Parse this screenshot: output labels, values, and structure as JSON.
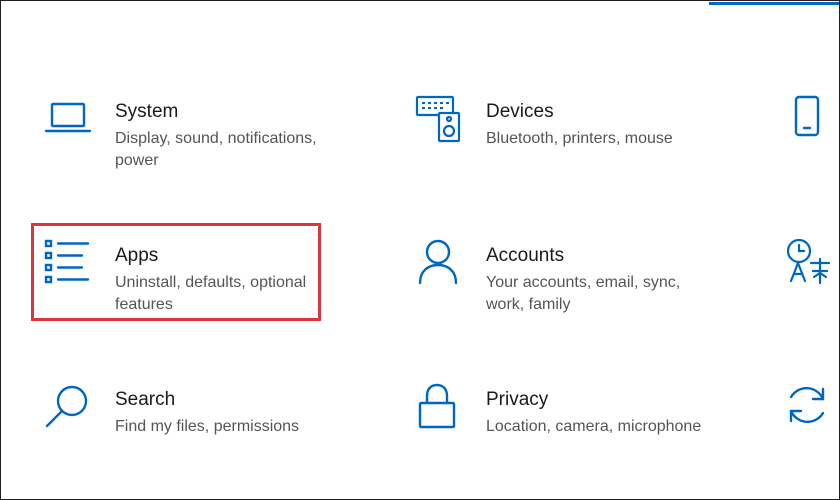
{
  "accent_color": "#0067c0",
  "highlight_color": "#d9363e",
  "tiles": [
    {
      "icon": "laptop-icon",
      "title": "System",
      "description": "Display, sound, notifications, power"
    },
    {
      "icon": "keyboard-speaker-icon",
      "title": "Devices",
      "description": "Bluetooth, printers, mouse"
    },
    {
      "icon": "apps-list-icon",
      "title": "Apps",
      "description": "Uninstall, defaults, optional features"
    },
    {
      "icon": "person-icon",
      "title": "Accounts",
      "description": "Your accounts, email, sync, work, family"
    },
    {
      "icon": "search-icon",
      "title": "Search",
      "description": "Find my files, permissions"
    },
    {
      "icon": "lock-icon",
      "title": "Privacy",
      "description": "Location, camera, microphone"
    }
  ],
  "edge_icons": [
    "phone-icon",
    "time-language-icon",
    "update-sync-icon"
  ]
}
